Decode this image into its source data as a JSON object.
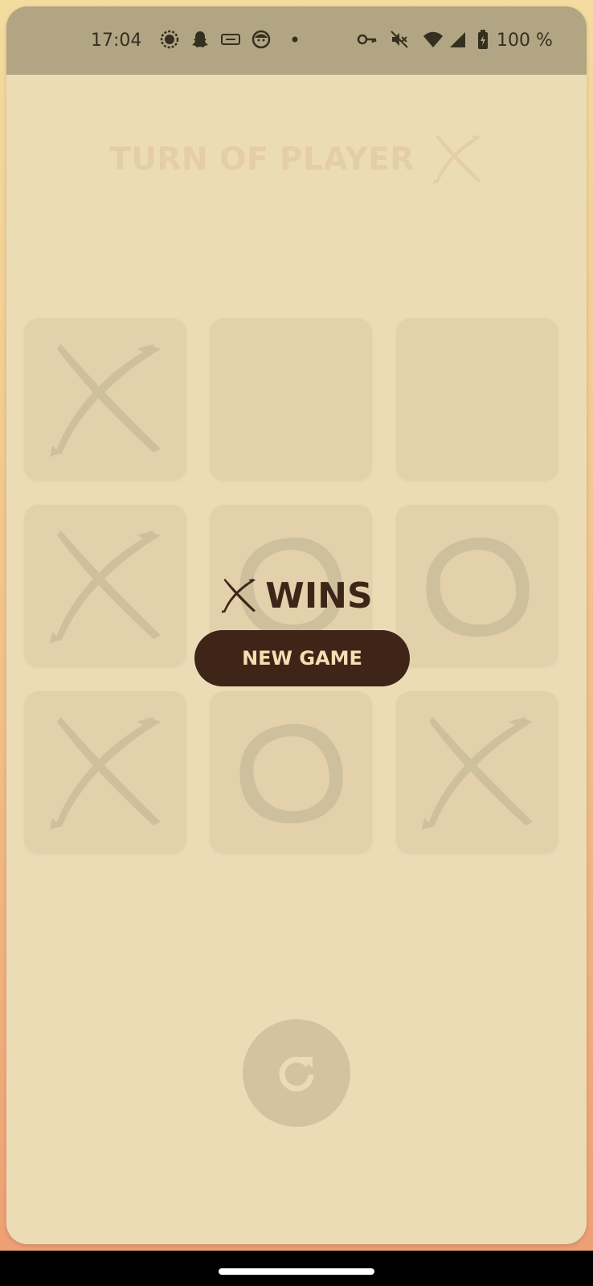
{
  "status_bar": {
    "time": "17:04",
    "notification_icons": [
      "chat-bubble-icon",
      "snapchat-icon",
      "ticket-icon",
      "face-icon",
      "dot-icon"
    ],
    "system_icons": [
      "key-icon",
      "mute-icon",
      "wifi-icon",
      "signal-icon",
      "battery-icon"
    ],
    "battery": "100 %"
  },
  "header": {
    "turn_label": "TURN OF PLAYER",
    "turn_icon": "x-mark-icon"
  },
  "board": {
    "cells": [
      "X",
      "",
      "",
      "X",
      "O",
      "O",
      "X",
      "O",
      "X"
    ]
  },
  "result": {
    "winner_icon": "x-mark-icon",
    "text": "WINS",
    "new_game_label": "NEW GAME"
  },
  "controls": {
    "restart_icon": "restart-icon"
  },
  "colors": {
    "background": "#ecdcb6",
    "cell": "#e3d1ab",
    "mark": "#cfc09d",
    "dark": "#3e2518",
    "button_text": "#f4dfb2"
  }
}
